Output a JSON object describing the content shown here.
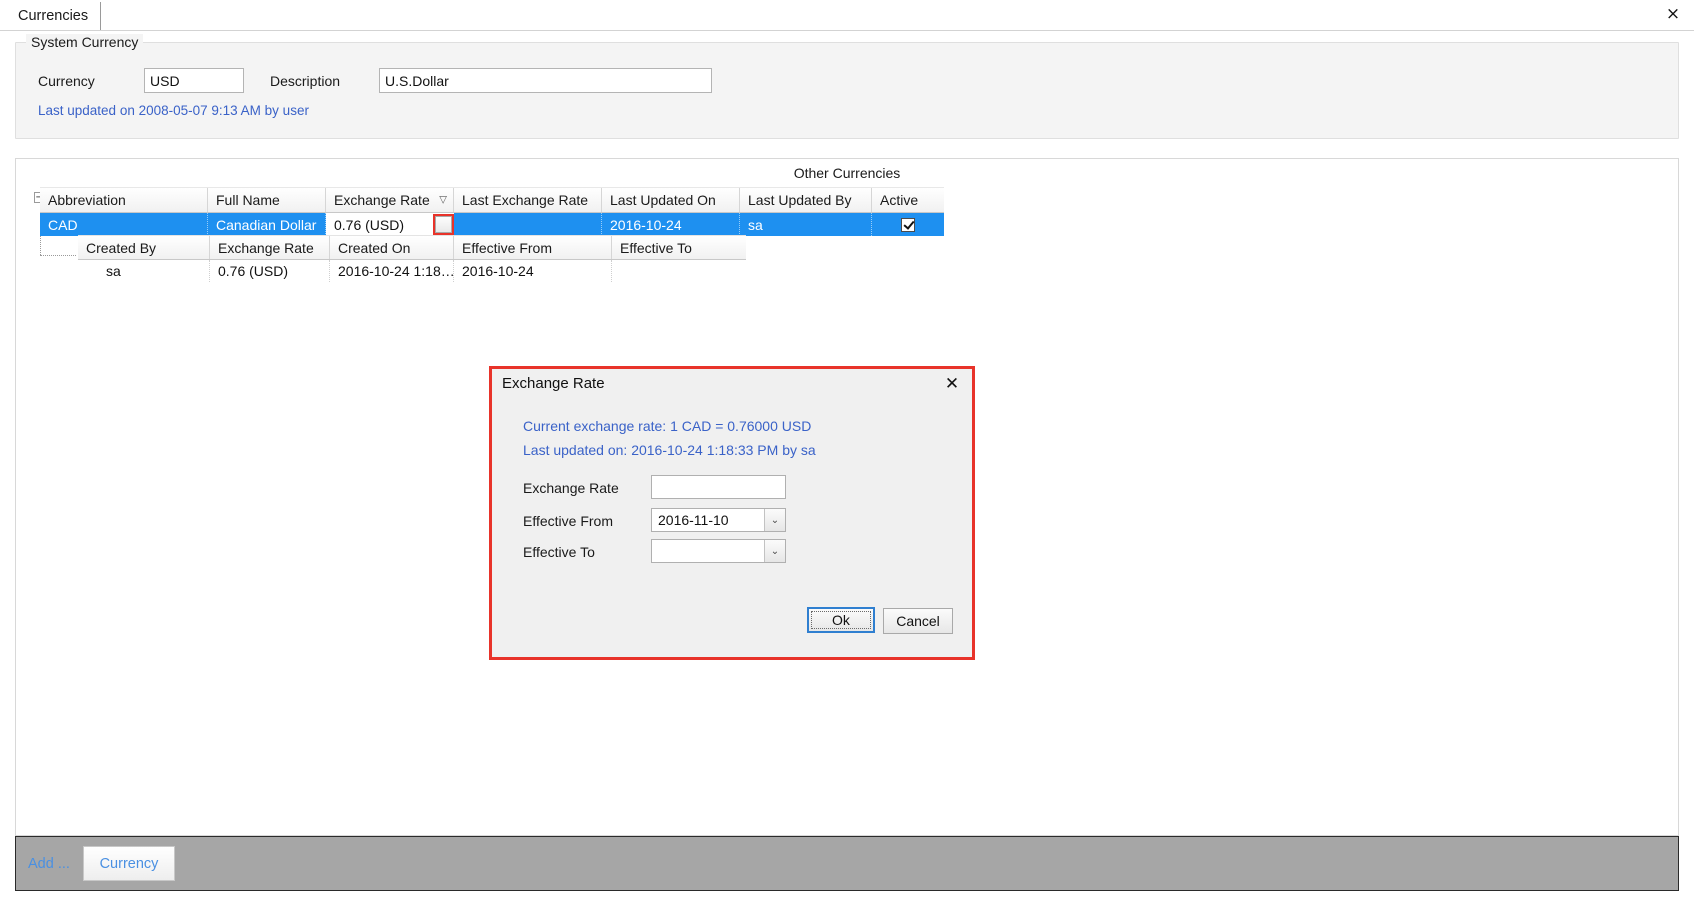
{
  "tab": {
    "label": "Currencies",
    "close_icon": "×"
  },
  "system_currency": {
    "group_title": "System Currency",
    "currency_label": "Currency",
    "currency_value": "USD",
    "description_label": "Description",
    "description_value": "U.S.Dollar",
    "last_updated": "Last updated on 2008-05-07 9:13 AM by user"
  },
  "other_currencies": {
    "caption": "Other Currencies",
    "columns": [
      "Abbreviation",
      "Full Name",
      "Exchange Rate",
      "Last Exchange Rate",
      "Last Updated On",
      "Last Updated By",
      "Active"
    ],
    "sort_glyph": "▽",
    "sorted_column": "Exchange Rate",
    "expander_glyph": "−",
    "row_indicator_glyph": "▶",
    "row": {
      "abbreviation": "CAD",
      "full_name": "Canadian Dollar",
      "exchange_rate": "0.76 (USD)",
      "last_exchange_rate": "",
      "last_updated_on": "2016-10-24",
      "last_updated_by": "sa",
      "active": true
    },
    "detail": {
      "columns": [
        "Created By",
        "Exchange Rate",
        "Created On",
        "Effective From",
        "Effective To"
      ],
      "row": {
        "created_by": "sa",
        "exchange_rate": "0.76 (USD)",
        "created_on": "2016-10-24  1:18…",
        "effective_from": "2016-10-24",
        "effective_to": ""
      }
    }
  },
  "dialog": {
    "title": "Exchange Rate",
    "close_icon": "✕",
    "current_rate": "Current exchange rate: 1 CAD = 0.76000 USD",
    "last_updated": "Last updated on: 2016-10-24 1:18:33 PM by sa",
    "exchange_rate_label": "Exchange Rate",
    "exchange_rate_value": "",
    "exchange_rate_placeholder": "",
    "effective_from_label": "Effective From",
    "effective_from_value": "2016-11-10",
    "effective_to_label": "Effective To",
    "effective_to_value": "",
    "dropdown_glyph": "⌄",
    "ok_label": "Ok",
    "cancel_label": "Cancel"
  },
  "bottom_bar": {
    "add_label": "Add ...",
    "currency_button": "Currency"
  },
  "colors": {
    "selection_blue": "#1e90f0",
    "link_blue": "#3a62c8",
    "highlight_red": "#e8332a",
    "bottom_bar_gray": "#a6a6a6",
    "button_blue_text": "#4a90e2"
  }
}
